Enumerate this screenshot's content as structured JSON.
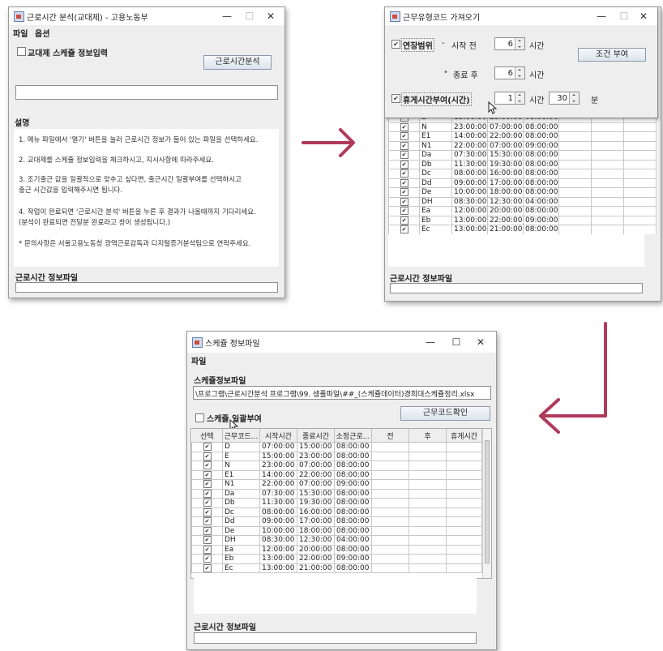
{
  "accent_color": "#b03a5b",
  "win1": {
    "title": "근로시간 분석(교대제) - 고용노동부",
    "menu": [
      "파일",
      "옵션"
    ],
    "schedule_check_label": "교대제 스케쥴 정보입력",
    "analyze_button": "근로시간분석",
    "desc_title": "설명",
    "desc_lines": [
      "1. 메뉴 파일에서 '열기' 버튼을 눌러 근로시간 정보가 들어 있는 파일을 선택하세요.",
      "2. 교대제를 스케쥴 정보입력을 체크하시고, 지시사항에 따라주세요.",
      "3. 조기출근 값을 일괄적으로 맞추고 싶다면, 출근시간 일괄부여를 선택하시고",
      "   출근 시간값을 입력해주시면 됩니다.",
      "4. 작업이 완료되면 '근로시간 분석' 버튼을 누른 후 결과가 나올때까지 기다리세요.",
      "(분석이 완료되면 전달분 완료라고 창이 생성됩니다.)",
      "* 문의사항은 서울고용노동청 광역근로감독과 디지털증거분석팀으로 연락주세요."
    ],
    "file_label": "근로시간 정보파일"
  },
  "win2": {
    "title": "근무유형코드 가져오기",
    "extend_label": "연장범위",
    "dash": "-",
    "before_label": "시작 전",
    "before_value": "6",
    "before_unit": "시간",
    "apply_button": "조건 부여",
    "bullet": "•",
    "after_label": "종료 후",
    "after_value": "6",
    "after_unit": "시간",
    "break_label": "휴게시간부여(시간)",
    "break_hours": "1",
    "break_hours_unit": "시간",
    "break_minutes": "30",
    "break_minutes_unit": "분",
    "rows": [
      [
        "E",
        "15:00:00",
        "23:00:00",
        "08:00:00"
      ],
      [
        "N",
        "23:00:00",
        "07:00:00",
        "08:00:00"
      ],
      [
        "E1",
        "14:00:00",
        "22:00:00",
        "08:00:00"
      ],
      [
        "N1",
        "22:00:00",
        "07:00:00",
        "09:00:00"
      ],
      [
        "Da",
        "07:30:00",
        "15:30:00",
        "08:00:00"
      ],
      [
        "Db",
        "11:30:00",
        "19:30:00",
        "08:00:00"
      ],
      [
        "Dc",
        "08:00:00",
        "16:00:00",
        "08:00:00"
      ],
      [
        "Dd",
        "09:00:00",
        "17:00:00",
        "08:00:00"
      ],
      [
        "De",
        "10:00:00",
        "18:00:00",
        "08:00:00"
      ],
      [
        "DH",
        "08:30:00",
        "12:30:00",
        "04:00:00"
      ],
      [
        "Ea",
        "12:00:00",
        "20:00:00",
        "08:00:00"
      ],
      [
        "Eb",
        "13:00:00",
        "22:00:00",
        "09:00:00"
      ],
      [
        "Ec",
        "13:00:00",
        "21:00:00",
        "08:00:00"
      ]
    ],
    "file_label": "근로시간 정보파일"
  },
  "win3": {
    "title": "스케쥴 정보파일",
    "menu": [
      "파일"
    ],
    "section_label": "스케쥴정보파일",
    "file_path": "\\프로그램\\근로시간분석 프로그램\\99. 샘플파일\\##_(스케쥴데이터)경희대스케쥴정리.xlsx",
    "bulk_check_label": "스케쥴 일괄부여",
    "confirm_button": "근무코드확인",
    "headers": [
      "선택",
      "근무코드...",
      "시작시간",
      "종료시간",
      "소정근로...",
      "전",
      "후",
      "휴게시간"
    ],
    "rows": [
      [
        "D",
        "07:00:00",
        "15:00:00",
        "08:00:00"
      ],
      [
        "E",
        "15:00:00",
        "23:00:00",
        "08:00:00"
      ],
      [
        "N",
        "23:00:00",
        "07:00:00",
        "08:00:00"
      ],
      [
        "E1",
        "14:00:00",
        "22:00:00",
        "08:00:00"
      ],
      [
        "N1",
        "22:00:00",
        "07:00:00",
        "09:00:00"
      ],
      [
        "Da",
        "07:30:00",
        "15:30:00",
        "08:00:00"
      ],
      [
        "Db",
        "11:30:00",
        "19:30:00",
        "08:00:00"
      ],
      [
        "Dc",
        "08:00:00",
        "16:00:00",
        "08:00:00"
      ],
      [
        "Dd",
        "09:00:00",
        "17:00:00",
        "08:00:00"
      ],
      [
        "De",
        "10:00:00",
        "18:00:00",
        "08:00:00"
      ],
      [
        "DH",
        "08:30:00",
        "12:30:00",
        "04:00:00"
      ],
      [
        "Ea",
        "12:00:00",
        "20:00:00",
        "08:00:00"
      ],
      [
        "Eb",
        "13:00:00",
        "22:00:00",
        "09:00:00"
      ],
      [
        "Ec",
        "13:00:00",
        "21:00:00",
        "08:00:00"
      ]
    ],
    "file_label": "근로시간 정보파일"
  },
  "window_controls": {
    "minimize": "—",
    "maximize": "☐",
    "close": "✕"
  },
  "check_glyph": "✔"
}
